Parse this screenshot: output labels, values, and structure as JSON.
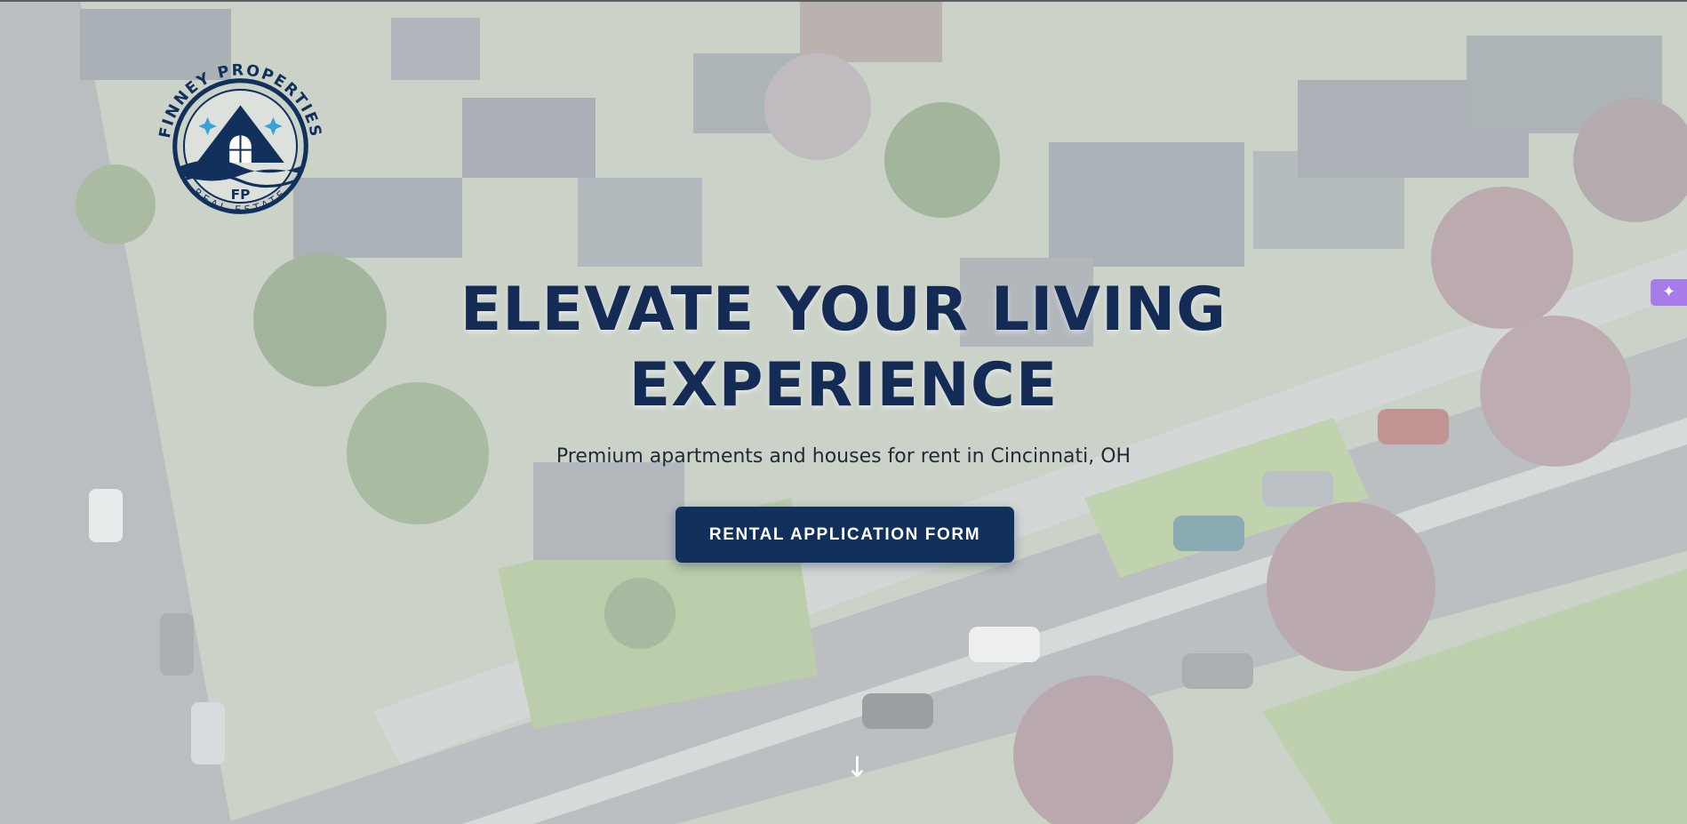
{
  "logo": {
    "arc_text": "FINNEY PROPERTIES",
    "monogram": "FP",
    "sub_text": "REAL ESTATE",
    "color": "#12305c",
    "accent": "#3aa3d6"
  },
  "hero": {
    "title_line1": "ELEVATE YOUR LIVING",
    "title_line2": "EXPERIENCE",
    "subtitle": "Premium apartments and houses for rent in Cincinnati, OH",
    "cta_label": "RENTAL APPLICATION FORM",
    "scroll_icon": "↓",
    "background": "aerial-neighborhood-photo"
  },
  "widget": {
    "icon": "✦",
    "color": "#a77be8"
  },
  "colors": {
    "navy": "#132b55",
    "button": "#12305c"
  }
}
